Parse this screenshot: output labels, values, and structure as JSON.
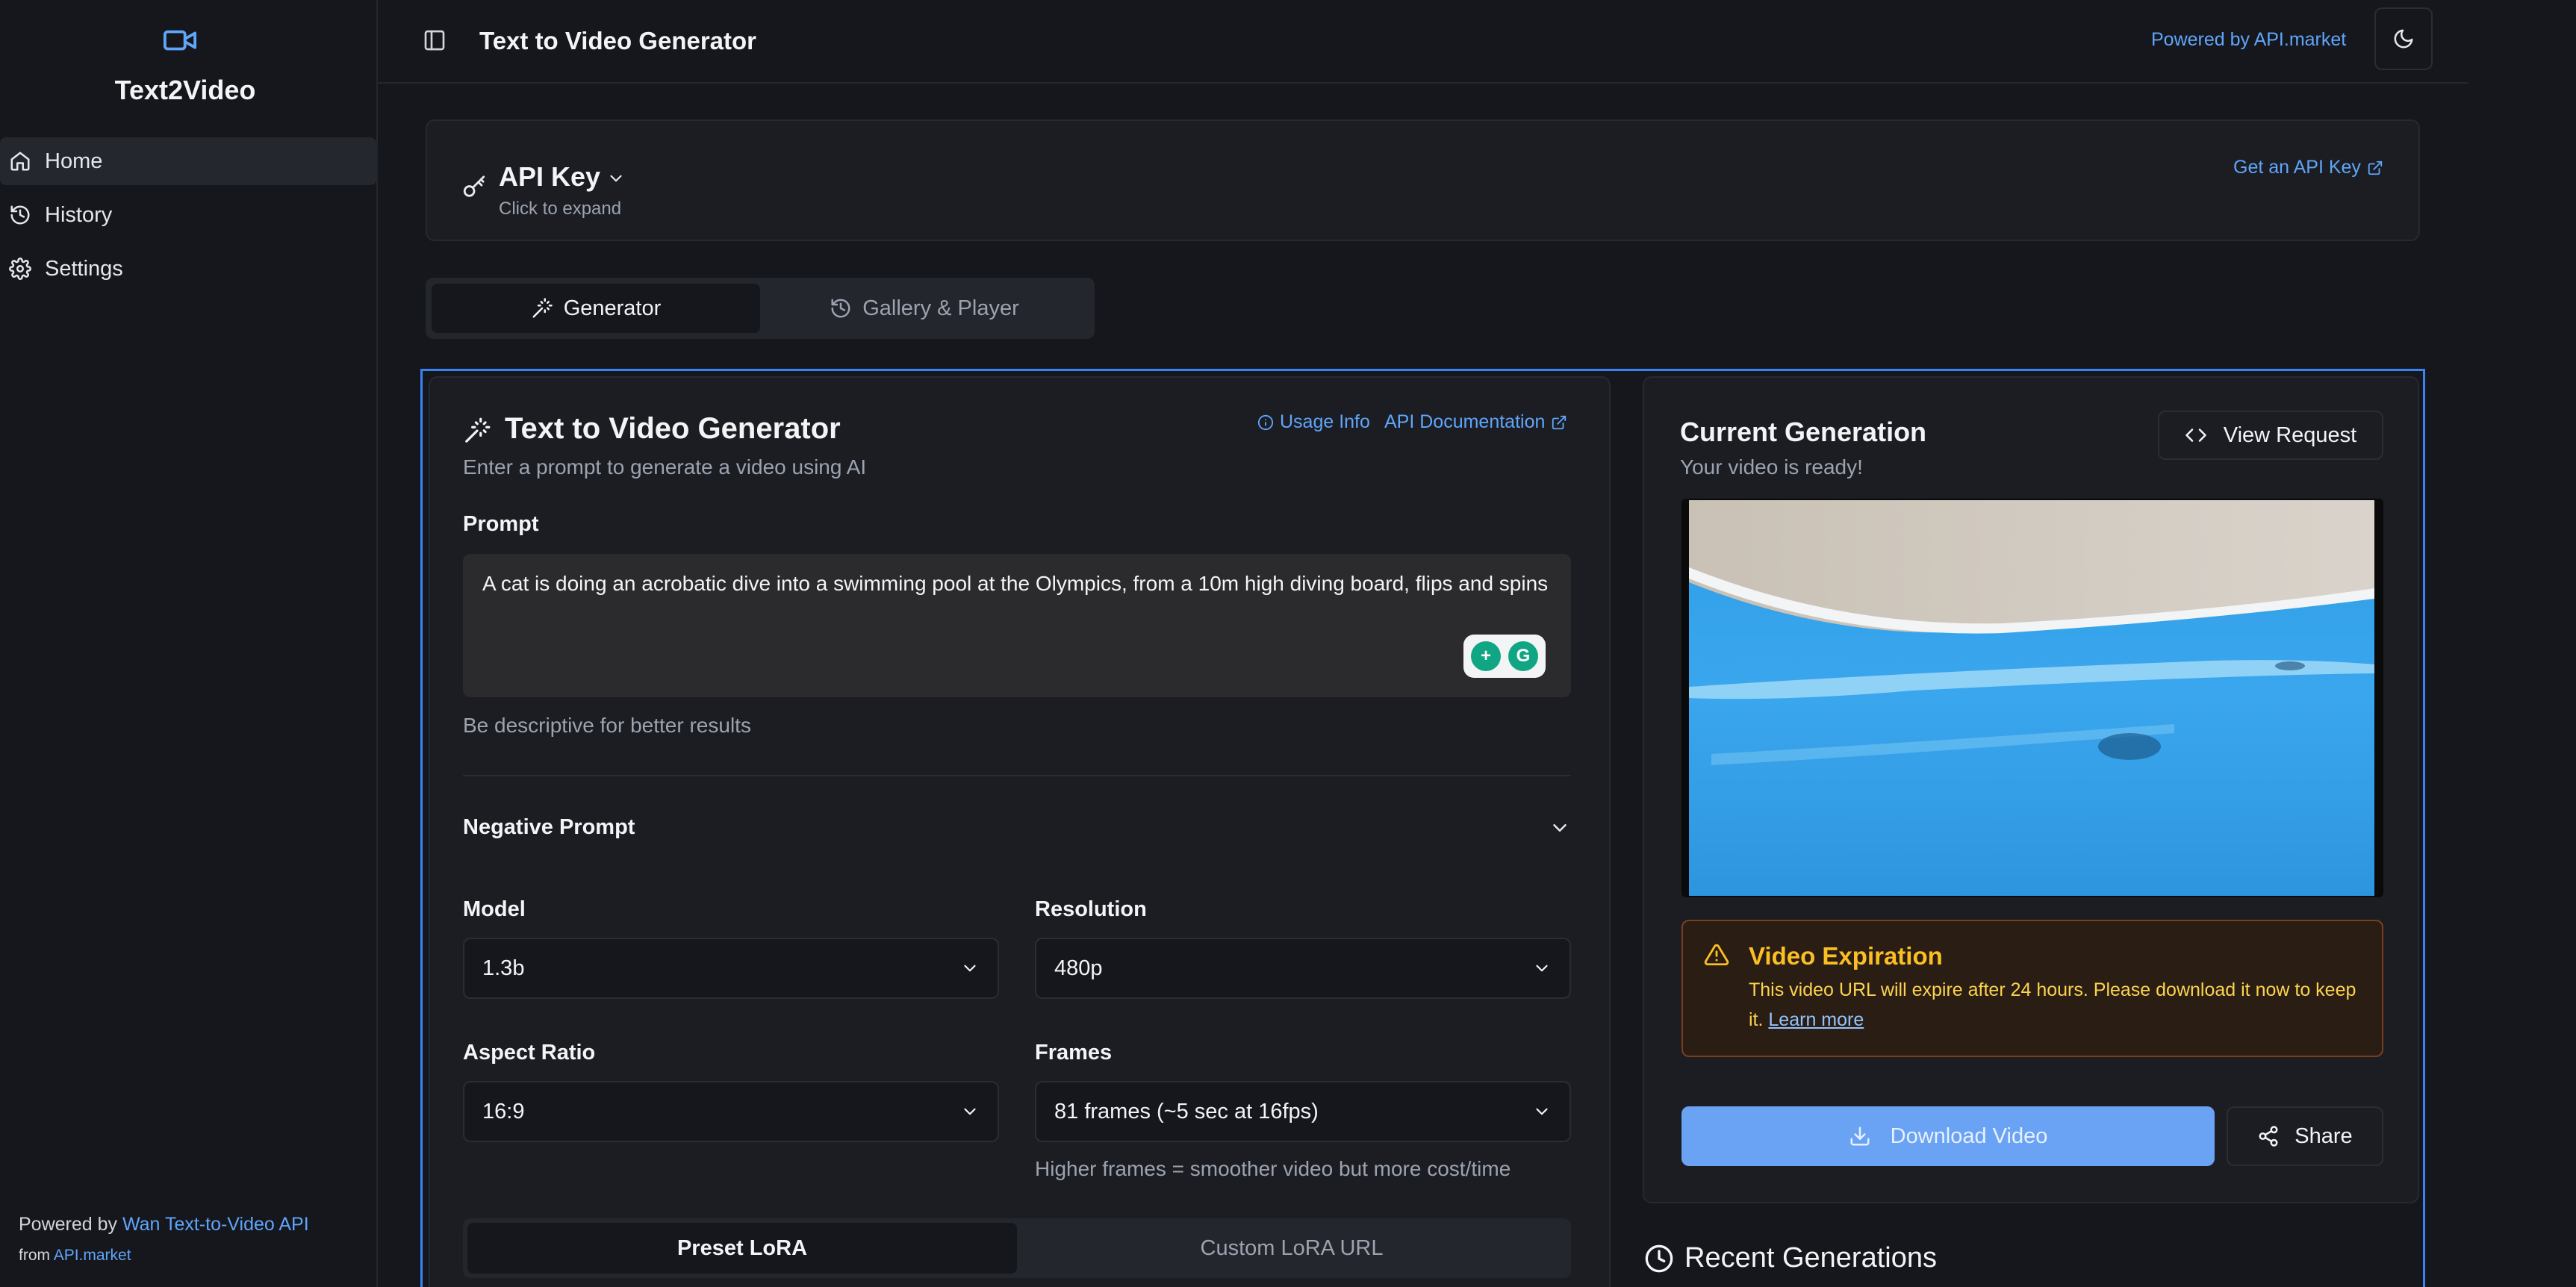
{
  "sidebar": {
    "brand": "Text2Video",
    "items": [
      {
        "label": "Home",
        "icon": "home-icon"
      },
      {
        "label": "History",
        "icon": "history-icon"
      },
      {
        "label": "Settings",
        "icon": "gear-icon"
      }
    ],
    "footer": {
      "powered_prefix": "Powered by",
      "powered_link": "Wan Text-to-Video API",
      "from_prefix": "from",
      "from_link": "API.market"
    }
  },
  "header": {
    "title": "Text to Video Generator",
    "powered": "Powered by API.market"
  },
  "api_key": {
    "title": "API Key",
    "subtitle": "Click to expand",
    "get_key": "Get an API Key"
  },
  "tabs": [
    {
      "label": "Generator"
    },
    {
      "label": "Gallery & Player"
    }
  ],
  "generator": {
    "title": "Text to Video Generator",
    "subtitle": "Enter a prompt to generate a video using AI",
    "usage_info": "Usage Info",
    "api_docs": "API Documentation",
    "prompt_label": "Prompt",
    "prompt_value": "A cat is doing an acrobatic dive into a swimming pool at the Olympics, from a 10m high diving board, flips and spins",
    "prompt_hint": "Be descriptive for better results",
    "negative_prompt_label": "Negative Prompt",
    "model": {
      "label": "Model",
      "value": "1.3b"
    },
    "resolution": {
      "label": "Resolution",
      "value": "480p"
    },
    "aspect_ratio": {
      "label": "Aspect Ratio",
      "value": "16:9"
    },
    "frames": {
      "label": "Frames",
      "value": "81 frames (~5 sec at 16fps)",
      "hint": "Higher frames = smoother video but more cost/time"
    },
    "lora_tabs": [
      "Preset LoRA",
      "Custom LoRA URL"
    ]
  },
  "current": {
    "title": "Current Generation",
    "subtitle": "Your video is ready!",
    "view_request": "View Request",
    "expiration": {
      "title": "Video Expiration",
      "text": "This video URL will expire after 24 hours. Please download it now to keep it.",
      "link": "Learn more"
    },
    "download": "Download Video",
    "share": "Share"
  },
  "recent": {
    "title": "Recent Generations"
  },
  "colors": {
    "background": "#15171d",
    "card": "#1b1d23",
    "accent": "#3b82f6",
    "link": "#60a5fa",
    "warning": "#fbbf24"
  }
}
